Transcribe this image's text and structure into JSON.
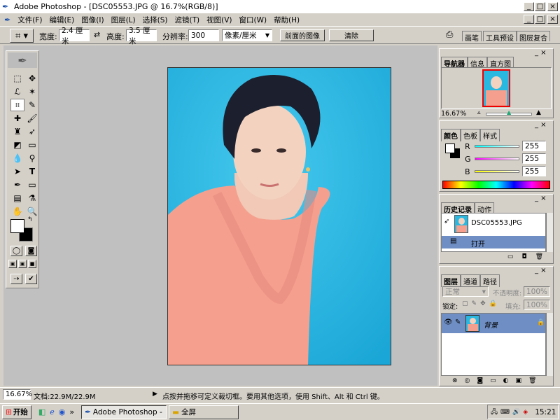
{
  "window": {
    "title": "Adobe Photoshop - [DSC05553.JPG @ 16.7%(RGB/8)]",
    "min_btn": "_",
    "max_btn": "□",
    "close_btn": "×"
  },
  "menu": [
    "文件(F)",
    "编辑(E)",
    "图像(I)",
    "图层(L)",
    "选择(S)",
    "滤镜(T)",
    "视图(V)",
    "窗口(W)",
    "帮助(H)"
  ],
  "options": {
    "width_label": "宽度:",
    "width_value": "2.4 厘米",
    "height_label": "高度:",
    "height_value": "3.5 厘米",
    "resolution_label": "分辨率:",
    "resolution_value": "300",
    "unit_value": "像素/厘米",
    "front_image_btn": "前面的图像",
    "clear_btn": "清除",
    "right_tabs": [
      "画笔",
      "工具预设",
      "图层复合"
    ]
  },
  "navigator": {
    "tabs": [
      "导航器",
      "信息",
      "直方图"
    ],
    "zoom": "16.67%"
  },
  "color": {
    "tabs": [
      "颜色",
      "色板",
      "样式"
    ],
    "channels": [
      {
        "label": "R",
        "value": "255",
        "color": "#ff0000"
      },
      {
        "label": "G",
        "value": "255",
        "color": "#ff00ff"
      },
      {
        "label": "B",
        "value": "255",
        "color": "#ffff00"
      }
    ]
  },
  "history": {
    "tabs": [
      "历史记录",
      "动作"
    ],
    "snapshot": "DSC05553.JPG",
    "item": "打开"
  },
  "layers": {
    "tabs": [
      "图层",
      "通道",
      "路径"
    ],
    "blend_mode": "正常",
    "opacity_label": "不透明度:",
    "opacity_value": "100%",
    "lock_label": "锁定:",
    "fill_label": "填充:",
    "fill_value": "100%",
    "layer_name": "背景"
  },
  "status": {
    "zoom": "16.67%",
    "doc": "文档:22.9M/22.9M",
    "hint": "点按并拖移可定义裁切框。要用其他选项，使用 Shift、Alt 和 Ctrl 键。"
  },
  "taskbar": {
    "start": "开始",
    "quick_more": "»",
    "task1": "Adobe Photoshop - [DSC...",
    "task2": "全屏",
    "clock": "15:21"
  },
  "colors": {
    "photo_bg": "#2ab8e0",
    "selected_row": "#6f8fc4",
    "titlebar_bg": "#ffffff"
  }
}
